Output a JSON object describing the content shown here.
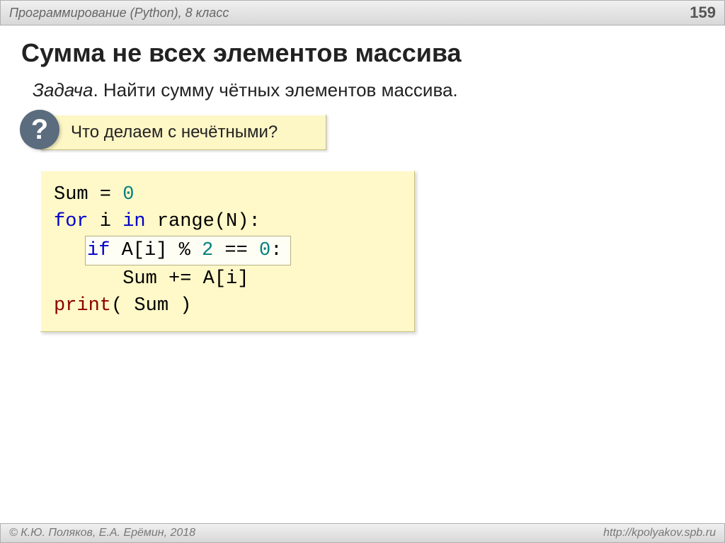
{
  "header": {
    "course": "Программирование (Python), 8 класс",
    "page": "159"
  },
  "title": "Сумма не всех элементов массива",
  "task": {
    "label": "Задача",
    "text": ". Найти сумму чётных элементов массива."
  },
  "question": {
    "mark": "?",
    "text": " Что делаем с нечётными?"
  },
  "code": {
    "l1_a": "Sum = ",
    "l1_b": "0",
    "l2_a": "for",
    "l2_b": " i ",
    "l2_c": "in",
    "l2_d": " range(N):",
    "l3_a": "if",
    "l3_b": " A[i] % ",
    "l3_c": "2",
    "l3_d": " == ",
    "l3_e": "0",
    "l3_f": ":",
    "l4": "      Sum += A[i]",
    "l5_a": "print",
    "l5_b": "( Sum )"
  },
  "footer": {
    "copyright": "© К.Ю. Поляков, Е.А. Ерёмин, 2018",
    "url": "http://kpolyakov.spb.ru"
  }
}
